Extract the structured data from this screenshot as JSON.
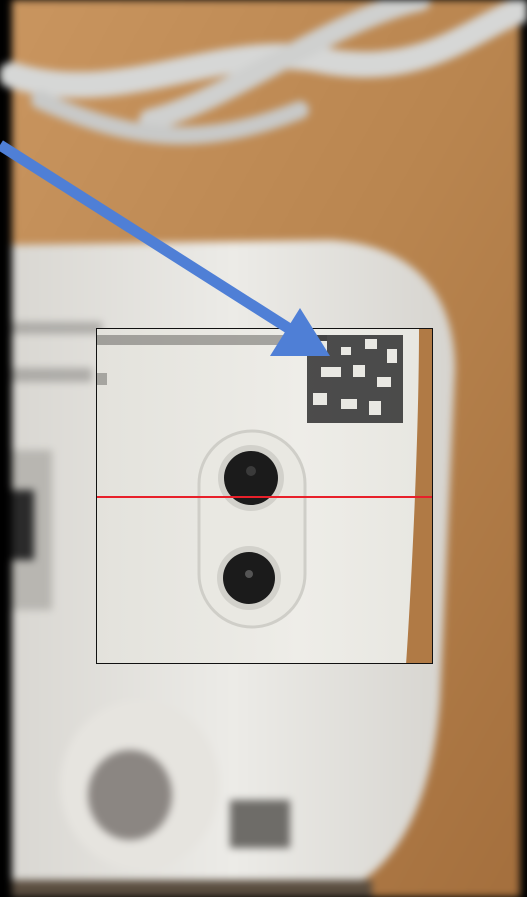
{
  "scanner": {
    "scan_line_color": "#e8202a",
    "frame_border_color": "#111111",
    "arrow_color": "#4f7fd6"
  },
  "icons": {
    "pointer_arrow": "arrow-icon",
    "qr_code": "qr-code-icon",
    "power_jack": "dc-jack-icon"
  }
}
